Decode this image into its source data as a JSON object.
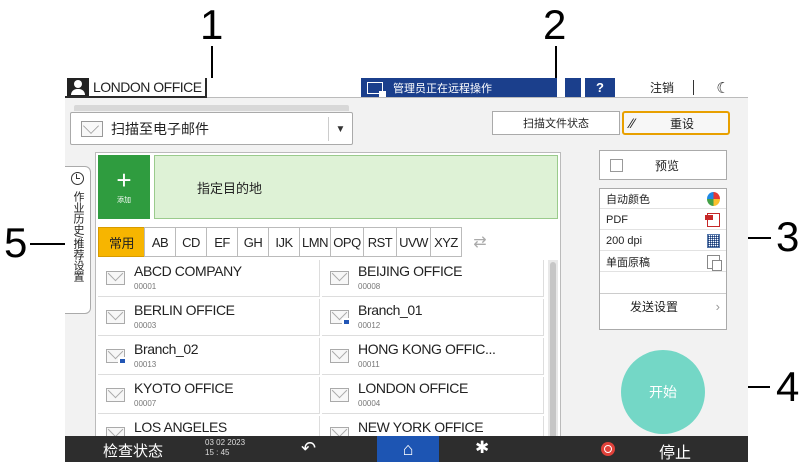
{
  "callouts": [
    "1",
    "2",
    "3",
    "4",
    "5"
  ],
  "topbar": {
    "office_name": "LONDON OFFICE",
    "remote_notice": "管理员正在远程操作",
    "help": "?",
    "logout": "注销",
    "moon": "☾"
  },
  "function_select": {
    "label": "扫描至电子邮件"
  },
  "scan_status_label": "扫描文件状态",
  "reset_label": "重设",
  "side_tab_label": "作业历史/推荐设置",
  "destination": {
    "add_label": "添加",
    "prompt": "指定目的地",
    "tabs": [
      "常用",
      "AB",
      "CD",
      "EF",
      "GH",
      "IJK",
      "LMN",
      "OPQ",
      "RST",
      "UVW",
      "XYZ"
    ],
    "entries": [
      {
        "name": "ABCD COMPANY",
        "number": "00001",
        "group": false
      },
      {
        "name": "BEIJING OFFICE",
        "number": "00008",
        "group": false
      },
      {
        "name": "BERLIN OFFICE",
        "number": "00003",
        "group": false
      },
      {
        "name": "Branch_01",
        "number": "00012",
        "group": true
      },
      {
        "name": "Branch_02",
        "number": "00013",
        "group": true
      },
      {
        "name": "HONG KONG OFFIC...",
        "number": "00011",
        "group": false
      },
      {
        "name": "KYOTO OFFICE",
        "number": "00007",
        "group": false
      },
      {
        "name": "LONDON OFFICE",
        "number": "00004",
        "group": false
      },
      {
        "name": "LOS ANGELES",
        "number": "",
        "group": false
      },
      {
        "name": "NEW YORK OFFICE",
        "number": "",
        "group": false
      }
    ]
  },
  "settings": {
    "preview": "预览",
    "items": [
      {
        "label": "自动颜色",
        "icon": "color-icon"
      },
      {
        "label": "PDF",
        "icon": "pdf-icon"
      },
      {
        "label": "200 dpi",
        "icon": "resolution-icon"
      },
      {
        "label": "单面原稿",
        "icon": "simplex-icon"
      }
    ],
    "send_settings": "发送设置"
  },
  "start_label": "开始",
  "bottombar": {
    "check_status": "检查状态",
    "date": "03 02 2023",
    "time": "15 : 45",
    "stop": "停止"
  },
  "colors": {
    "accent_orange": "#f7b500",
    "add_green": "#2f9c3f",
    "home_blue": "#1d55b3",
    "start_teal": "#74d7c6"
  }
}
